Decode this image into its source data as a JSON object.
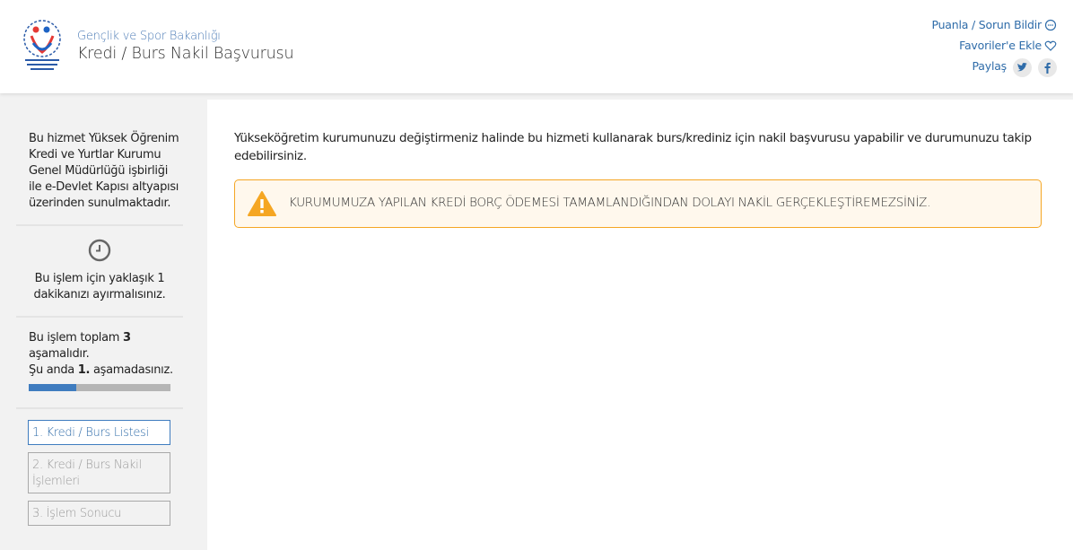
{
  "header": {
    "ministry": "Gençlik ve Spor Bakanlığı",
    "title": "Kredi / Burs Nakil Başvurusu",
    "links": {
      "rate": "Puanla / Sorun Bildir",
      "favorite": "Favoriler'e Ekle",
      "share": "Paylaş"
    }
  },
  "sidebar": {
    "intro": "Bu hizmet Yüksek Öğrenim Kredi ve Yurtlar Kurumu Genel Müdürlüğü işbirliği ile e-Devlet Kapısı altyapısı üzerinden sunulmaktadır.",
    "time_text": "Bu işlem için yaklaşık 1 dakikanızı ayırmalısınız.",
    "steps_info": {
      "total_prefix": "Bu işlem toplam ",
      "total": "3",
      "total_suffix": " aşamalıdır.",
      "current_prefix": "Şu anda ",
      "current": "1.",
      "current_suffix": " aşamadasınız."
    },
    "progress_fraction": 0.333,
    "steps": [
      {
        "label": "1. Kredi / Burs Listesi"
      },
      {
        "label": "2. Kredi / Burs Nakil İşlemleri"
      },
      {
        "label": "3. İşlem Sonucu"
      }
    ]
  },
  "main": {
    "description": "Yükseköğretim kurumunuzu değiştirmeniz halinde bu hizmeti kullanarak burs/krediniz için nakil başvurusu yapabilir ve durumunuzu takip edebilirsiniz.",
    "alert": "KURUMUMUZA YAPILAN KREDİ BORÇ ÖDEMESİ TAMAMLANDIĞINDAN DOLAYI NAKİL GERÇEKLEŞTİREMEZSİNİZ."
  },
  "colors": {
    "accent": "#3f7cbf",
    "link": "#2f6ca9",
    "warning": "#f5a623"
  },
  "icons": {
    "logo": "ministry-logo",
    "rate": "chat-icon",
    "favorite": "heart-icon",
    "twitter": "twitter-icon",
    "facebook": "facebook-icon",
    "time": "clock-icon",
    "alert": "warning-icon"
  }
}
